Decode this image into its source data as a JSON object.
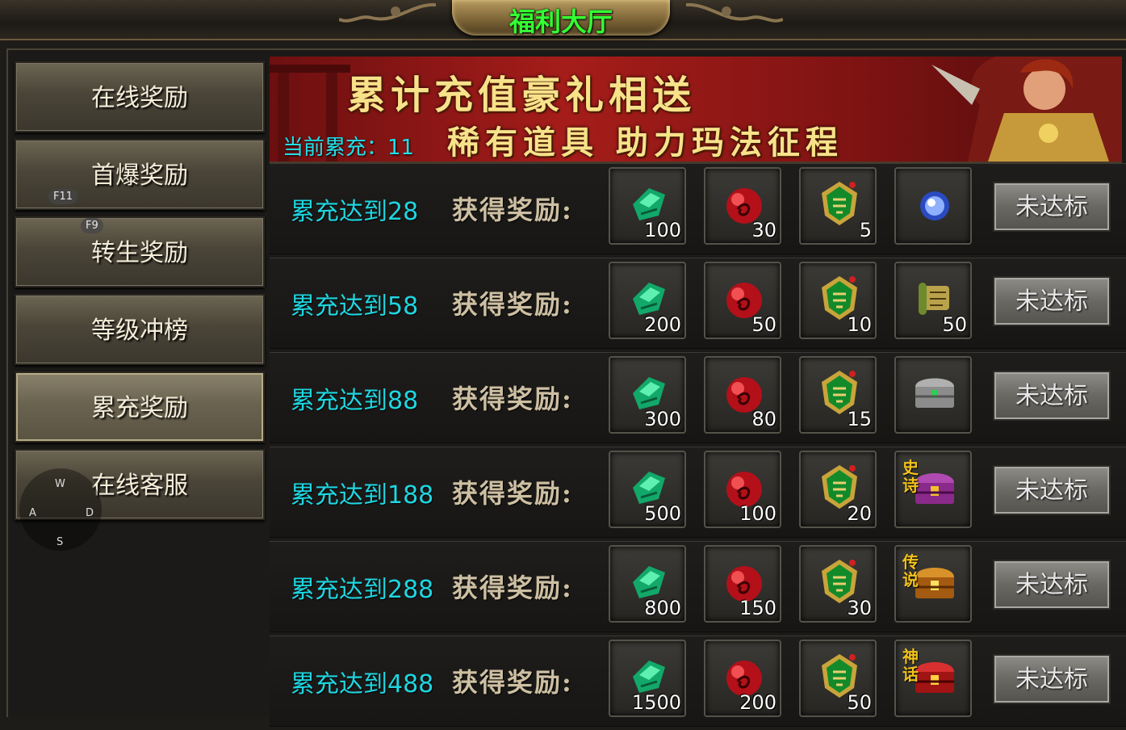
{
  "window": {
    "title": "福利大厅"
  },
  "sidebar": {
    "items": [
      {
        "label": "在线奖励"
      },
      {
        "label": "首爆奖励"
      },
      {
        "label": "转生奖励"
      },
      {
        "label": "等级冲榜"
      },
      {
        "label": "累充奖励",
        "active": true
      },
      {
        "label": "在线客服"
      }
    ]
  },
  "overlay": {
    "key_f11": "F11",
    "key_f9": "F9",
    "joystick": {
      "up": "W",
      "left": "A",
      "right": "D",
      "down": "S"
    }
  },
  "banner": {
    "line1": "累计充值豪礼相送",
    "line2": "稀有道具 助力玛法征程",
    "current_total": "当前累充：11"
  },
  "reward_prefix": "获得奖励:",
  "rows": [
    {
      "label": "累充达到28",
      "status": "未达标",
      "items": [
        {
          "icon": "jade-icon",
          "count": "100"
        },
        {
          "icon": "red-orb-icon",
          "count": "30"
        },
        {
          "icon": "medal-icon",
          "count": "5"
        },
        {
          "icon": "blue-gem-icon",
          "count": ""
        }
      ]
    },
    {
      "label": "累充达到58",
      "status": "未达标",
      "items": [
        {
          "icon": "jade-icon",
          "count": "200"
        },
        {
          "icon": "red-orb-icon",
          "count": "50"
        },
        {
          "icon": "medal-icon",
          "count": "10"
        },
        {
          "icon": "scroll-icon",
          "count": "50"
        }
      ]
    },
    {
      "label": "累充达到88",
      "status": "未达标",
      "items": [
        {
          "icon": "jade-icon",
          "count": "300"
        },
        {
          "icon": "red-orb-icon",
          "count": "80"
        },
        {
          "icon": "medal-icon",
          "count": "15"
        },
        {
          "icon": "silver-chest-icon",
          "count": ""
        }
      ]
    },
    {
      "label": "累充达到188",
      "status": "未达标",
      "items": [
        {
          "icon": "jade-icon",
          "count": "500"
        },
        {
          "icon": "red-orb-icon",
          "count": "100"
        },
        {
          "icon": "medal-icon",
          "count": "20"
        },
        {
          "icon": "epic-chest-icon",
          "count": "",
          "tag": "史诗"
        }
      ]
    },
    {
      "label": "累充达到288",
      "status": "未达标",
      "items": [
        {
          "icon": "jade-icon",
          "count": "800"
        },
        {
          "icon": "red-orb-icon",
          "count": "150"
        },
        {
          "icon": "medal-icon",
          "count": "30"
        },
        {
          "icon": "legend-chest-icon",
          "count": "",
          "tag": "传说"
        }
      ]
    },
    {
      "label": "累充达到488",
      "status": "未达标",
      "items": [
        {
          "icon": "jade-icon",
          "count": "1500"
        },
        {
          "icon": "red-orb-icon",
          "count": "200"
        },
        {
          "icon": "medal-icon",
          "count": "50"
        },
        {
          "icon": "myth-chest-icon",
          "count": "",
          "tag": "神话"
        }
      ]
    }
  ],
  "colors": {
    "title": "#33ff33",
    "cyan_text": "#1fd6e0",
    "banner_gold": "#f7e28a"
  }
}
